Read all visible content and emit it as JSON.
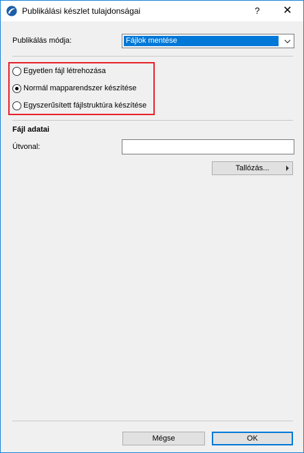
{
  "window": {
    "title": "Publikálási készlet tulajdonságai",
    "help_label": "?",
    "close_label": "✕"
  },
  "publish_mode": {
    "label": "Publikálás módja:",
    "selected": "Fájlok mentése"
  },
  "structure_options": [
    {
      "label": "Egyetlen fájl létrehozása",
      "checked": false
    },
    {
      "label": "Normál mapparendszer készítése",
      "checked": true
    },
    {
      "label": "Egyszerűsített fájlstruktúra készítése",
      "checked": false
    }
  ],
  "file_data": {
    "heading": "Fájl adatai",
    "path_label": "Útvonal:",
    "path_value": "",
    "browse_label": "Tallózás..."
  },
  "footer": {
    "cancel_label": "Mégse",
    "ok_label": "OK"
  },
  "colors": {
    "accent": "#0078d7",
    "highlight_border": "#e8202a"
  }
}
